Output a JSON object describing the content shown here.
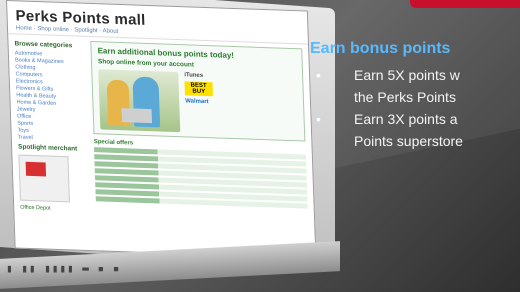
{
  "screen": {
    "site_title": "Perks Points mall",
    "nav_text": "Home · Shop online · Spotlight · About",
    "sidebar": {
      "heading": "Browse categories",
      "items": [
        "Automotive",
        "Books & Magazines",
        "Clothing",
        "Computers",
        "Electronics",
        "Flowers & Gifts",
        "Health & Beauty",
        "Home & Garden",
        "Jewelry",
        "Office",
        "Sports",
        "Toys",
        "Travel"
      ],
      "spotlight_heading": "Spotlight merchant",
      "spotlight_caption": "Office Depot"
    },
    "main": {
      "heading": "Earn additional bonus points today!",
      "subheading": "Shop online from your account",
      "brands": [
        "iTunes",
        "BEST BUY",
        "Walmart"
      ],
      "special_offers": "Special offers"
    }
  },
  "keyboard_glyphs": "▮ ▮▮ ▮▮▮▮ ▬ ▪ ▪",
  "panel": {
    "heading": "Earn bonus points",
    "bullets": [
      "Earn 5X points w",
      "the Perks Points",
      "Earn 3X points a",
      "Points superstore"
    ]
  },
  "colors": {
    "heading": "#58b9ff",
    "bullet_text": "#f4f4f4",
    "accent_red": "#c8102e"
  }
}
